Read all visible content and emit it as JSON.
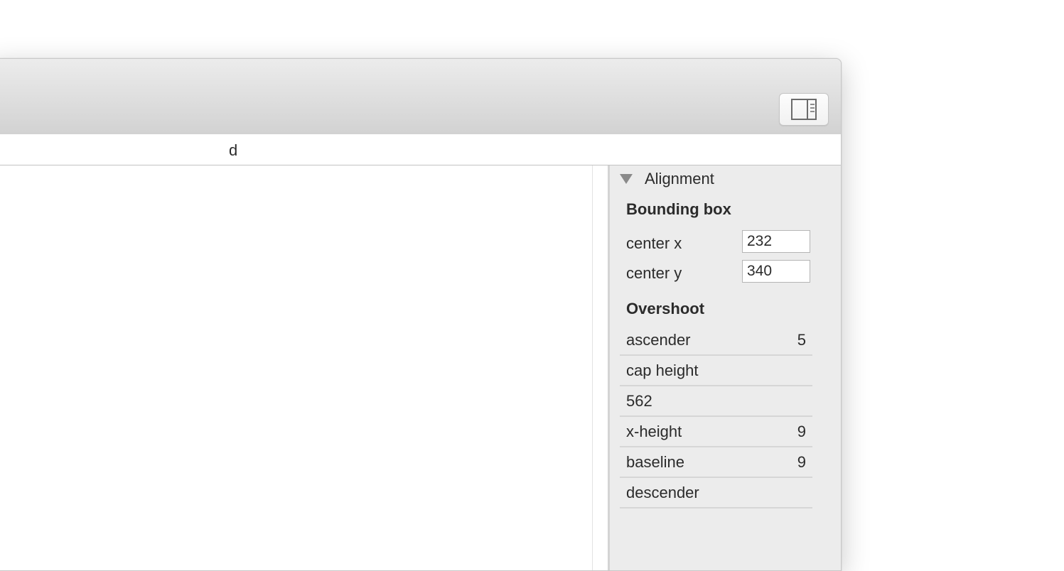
{
  "tab": {
    "label": "d"
  },
  "alignment": {
    "title": "Alignment",
    "bounding_box": {
      "heading": "Bounding box",
      "center_x": {
        "label": "center x",
        "value": "232"
      },
      "center_y": {
        "label": "center y",
        "value": "340"
      }
    },
    "overshoot": {
      "heading": "Overshoot",
      "rows": [
        {
          "label": "ascender",
          "value": "5"
        },
        {
          "label": "cap height",
          "value": ""
        },
        {
          "label": "562",
          "value": ""
        },
        {
          "label": "x-height",
          "value": "9"
        },
        {
          "label": "baseline",
          "value": "9"
        },
        {
          "label": "descender",
          "value": ""
        }
      ]
    }
  },
  "icons": {
    "toolbar_toggle": "sidebar-toggle-icon",
    "disclosure": "disclosure-triangle-icon"
  }
}
